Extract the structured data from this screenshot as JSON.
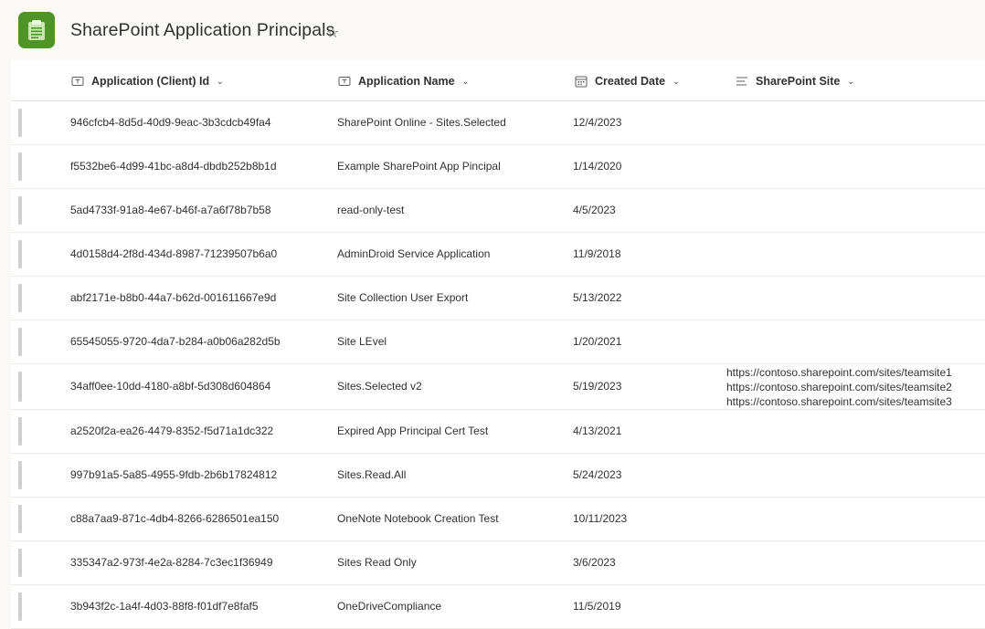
{
  "header": {
    "title": "SharePoint Application Principals",
    "star_icon": "☆"
  },
  "columns": [
    {
      "label": "Application (Client) Id",
      "icon": "text-field-icon"
    },
    {
      "label": "Application Name",
      "icon": "text-field-icon"
    },
    {
      "label": "Created Date",
      "icon": "calendar-icon"
    },
    {
      "label": "SharePoint Site",
      "icon": "multiline-text-icon"
    }
  ],
  "rows": [
    {
      "id": "946cfcb4-8d5d-40d9-9eac-3b3cdcb49fa4",
      "name": "SharePoint Online - Sites.Selected",
      "date": "12/4/2023",
      "sites": []
    },
    {
      "id": "f5532be6-4d99-41bc-a8d4-dbdb252b8b1d",
      "name": "Example SharePoint App Pincipal",
      "date": "1/14/2020",
      "sites": []
    },
    {
      "id": "5ad4733f-91a8-4e67-b46f-a7a6f78b7b58",
      "name": "read-only-test",
      "date": "4/5/2023",
      "sites": []
    },
    {
      "id": "4d0158d4-2f8d-434d-8987-71239507b6a0",
      "name": "AdminDroid Service Application",
      "date": "11/9/2018",
      "sites": []
    },
    {
      "id": "abf2171e-b8b0-44a7-b62d-001611667e9d",
      "name": "Site Collection User Export",
      "date": "5/13/2022",
      "sites": []
    },
    {
      "id": "65545055-9720-4da7-b284-a0b06a282d5b",
      "name": "Site LEvel",
      "date": "1/20/2021",
      "sites": []
    },
    {
      "id": "34aff0ee-10dd-4180-a8bf-5d308d604864",
      "name": "Sites.Selected v2",
      "date": "5/19/2023",
      "sites": [
        "https://contoso.sharepoint.com/sites/teamsite1",
        "https://contoso.sharepoint.com/sites/teamsite2",
        "https://contoso.sharepoint.com/sites/teamsite3"
      ]
    },
    {
      "id": "a2520f2a-ea26-4479-8352-f5d71a1dc322",
      "name": "Expired App Principal Cert Test",
      "date": "4/13/2021",
      "sites": []
    },
    {
      "id": "997b91a5-5a85-4955-9fdb-2b6b17824812",
      "name": "Sites.Read.All",
      "date": "5/24/2023",
      "sites": []
    },
    {
      "id": "c88a7aa9-871c-4db4-8266-6286501ea150",
      "name": "OneNote Notebook Creation Test",
      "date": "10/11/2023",
      "sites": []
    },
    {
      "id": "335347a2-973f-4e2a-8284-7c3ec1f36949",
      "name": "Sites Read Only",
      "date": "3/6/2023",
      "sites": []
    },
    {
      "id": "3b943f2c-1a4f-4d03-88f8-f01df7e8faf5",
      "name": "OneDriveCompliance",
      "date": "11/5/2019",
      "sites": []
    }
  ],
  "colors": {
    "brand": "#4e9427",
    "row_bar": "#d2d0ce",
    "divider": "#edebe9"
  }
}
